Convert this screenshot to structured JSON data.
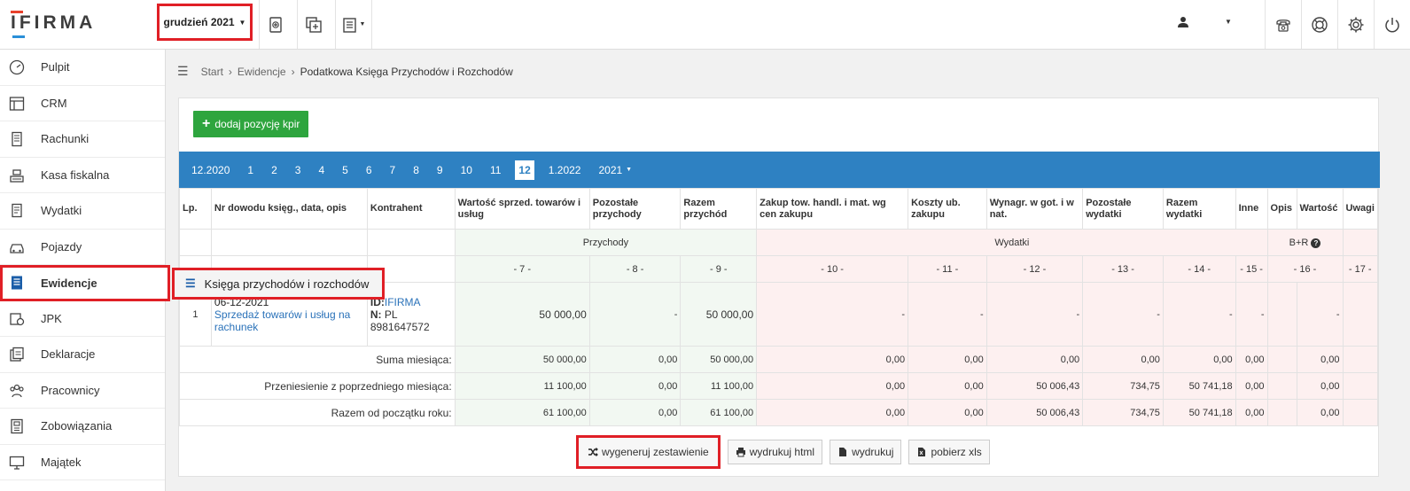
{
  "logo": "IFIRMA",
  "period": {
    "label": "grudzień 2021"
  },
  "sidebar": {
    "items": [
      {
        "label": "Pulpit",
        "icon": "gauge-icon"
      },
      {
        "label": "CRM",
        "icon": "layout-icon"
      },
      {
        "label": "Rachunki",
        "icon": "receipt-icon"
      },
      {
        "label": "Kasa fiskalna",
        "icon": "cash-register-icon"
      },
      {
        "label": "Wydatki",
        "icon": "expenses-icon"
      },
      {
        "label": "Pojazdy",
        "icon": "car-icon"
      },
      {
        "label": "Ewidencje",
        "icon": "ledger-icon"
      },
      {
        "label": "JPK",
        "icon": "jpk-icon"
      },
      {
        "label": "Deklaracje",
        "icon": "declarations-icon"
      },
      {
        "label": "Pracownicy",
        "icon": "employees-icon"
      },
      {
        "label": "Zobowiązania",
        "icon": "obligations-icon"
      },
      {
        "label": "Majątek",
        "icon": "monitor-icon"
      }
    ],
    "submenu": "Księga przychodów i rozchodów"
  },
  "breadcrumb": {
    "start": "Start",
    "ewidencje": "Ewidencje",
    "current": "Podatkowa Księga Przychodów i Rozchodów"
  },
  "add_button": "dodaj pozycję kpir",
  "months": {
    "prev": "12.2020",
    "list": [
      "1",
      "2",
      "3",
      "4",
      "5",
      "6",
      "7",
      "8",
      "9",
      "10",
      "11",
      "12"
    ],
    "selected": "12",
    "next": "1.2022",
    "year": "2021"
  },
  "table": {
    "headers": {
      "lp": "Lp.",
      "nr": "Nr dowodu księg., data, opis",
      "kontrahent": "Kontrahent",
      "c7": "Wartość sprzed. towarów i usług",
      "c8": "Pozostałe przychody",
      "c9": "Razem przychód",
      "c10": "Zakup tow. handl. i mat. wg cen zakupu",
      "c11": "Koszty ub. zakupu",
      "c12": "Wynagr. w got. i w nat.",
      "c13": "Pozostałe wydatki",
      "c14": "Razem wydatki",
      "c15": "Inne",
      "c16a": "Opis",
      "c16b": "Wartość",
      "c17": "Uwagi"
    },
    "groups": {
      "przychody": "Przychody",
      "wydatki": "Wydatki",
      "br": "B+R"
    },
    "colnums": [
      "- 7 -",
      "- 8 -",
      "- 9 -",
      "- 10 -",
      "- 11 -",
      "- 12 -",
      "- 13 -",
      "- 14 -",
      "- 15 -",
      "- 16 -",
      "- 17 -"
    ],
    "row": {
      "lp": "1",
      "date": "06-12-2021",
      "desc": "Sprzedaż towarów i usług na rachunek",
      "id_label": "ID:",
      "id_value": "IFIRMA",
      "n_label": "N:",
      "n_value": "PL 8981647572",
      "c7": "50 000,00",
      "c8": "-",
      "c9": "50 000,00",
      "c10": "-",
      "c11": "-",
      "c12": "-",
      "c13": "-",
      "c14": "-",
      "c15": "-",
      "c16": "-"
    },
    "sums": [
      {
        "label": "Suma miesiąca:",
        "c7": "50 000,00",
        "c8": "0,00",
        "c9": "50 000,00",
        "c10": "0,00",
        "c11": "0,00",
        "c12": "0,00",
        "c13": "0,00",
        "c14": "0,00",
        "c15": "0,00",
        "c16": "0,00"
      },
      {
        "label": "Przeniesienie z poprzedniego miesiąca:",
        "c7": "11 100,00",
        "c8": "0,00",
        "c9": "11 100,00",
        "c10": "0,00",
        "c11": "0,00",
        "c12": "50 006,43",
        "c13": "734,75",
        "c14": "50 741,18",
        "c15": "0,00",
        "c16": "0,00"
      },
      {
        "label": "Razem od początku roku:",
        "c7": "61 100,00",
        "c8": "0,00",
        "c9": "61 100,00",
        "c10": "0,00",
        "c11": "0,00",
        "c12": "50 006,43",
        "c13": "734,75",
        "c14": "50 741,18",
        "c15": "0,00",
        "c16": "0,00"
      }
    ]
  },
  "buttons": {
    "generate": "wygeneruj zestawienie",
    "print_html": "wydrukuj html",
    "print": "wydrukuj",
    "xls": "pobierz xls"
  }
}
